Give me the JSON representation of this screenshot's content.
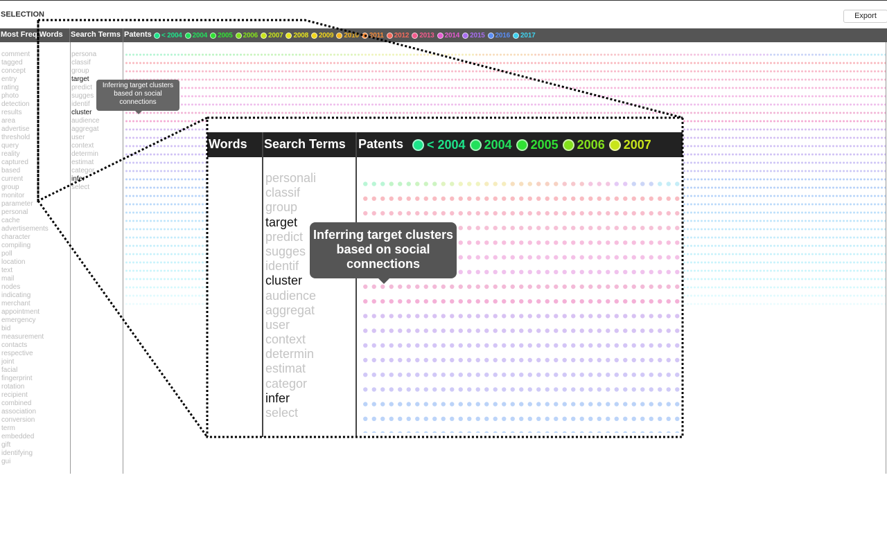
{
  "title": "SELECTION",
  "export_label": "Export",
  "columns": {
    "words": "Most Freq Words",
    "search_terms": "Search Terms",
    "patents": "Patents"
  },
  "legend": [
    {
      "label": "< 2004",
      "color": "#1de38a"
    },
    {
      "label": "2004",
      "color": "#22e05c"
    },
    {
      "label": "2005",
      "color": "#31e034"
    },
    {
      "label": "2006",
      "color": "#83e01c"
    },
    {
      "label": "2007",
      "color": "#c8e41b"
    },
    {
      "label": "2008",
      "color": "#e6e41c"
    },
    {
      "label": "2009",
      "color": "#f0d51c"
    },
    {
      "label": "2010",
      "color": "#f3b41f"
    },
    {
      "label": "2011",
      "color": "#f48a3a"
    },
    {
      "label": "2012",
      "color": "#f26a5c"
    },
    {
      "label": "2013",
      "color": "#f25b8d"
    },
    {
      "label": "2014",
      "color": "#e45ad0"
    },
    {
      "label": "2015",
      "color": "#a86ef0"
    },
    {
      "label": "2016",
      "color": "#5a8df3"
    },
    {
      "label": "2017",
      "color": "#3fd2ee"
    }
  ],
  "freq_words": [
    "comment",
    "tagged",
    "concept",
    "entry",
    "rating",
    "photo",
    "detection",
    "results",
    "area",
    "advertise",
    "threshold",
    "query",
    "reality",
    "captured",
    "based",
    "current",
    "group",
    "monitor",
    "parameter",
    "personal",
    "cache",
    "advertisements",
    "character",
    "compiling",
    "poll",
    "location",
    "text",
    "mail",
    "nodes",
    "indicating",
    "merchant",
    "appointment",
    "emergency",
    "bid",
    "measurement",
    "contacts",
    "respective",
    "joint",
    "facial",
    "fingerprint",
    "rotation",
    "recipient",
    "combined",
    "association",
    "conversion",
    "term",
    "embedded",
    "gift",
    "identifying",
    "gui"
  ],
  "search_terms": [
    {
      "text": "personali",
      "hl": false
    },
    {
      "text": "classif",
      "hl": false
    },
    {
      "text": "group",
      "hl": false
    },
    {
      "text": "target",
      "hl": true
    },
    {
      "text": "predict",
      "hl": false
    },
    {
      "text": "sugges",
      "hl": false
    },
    {
      "text": "identif",
      "hl": false
    },
    {
      "text": "cluster",
      "hl": true
    },
    {
      "text": "audience",
      "hl": false
    },
    {
      "text": "aggregat",
      "hl": false
    },
    {
      "text": "user",
      "hl": false
    },
    {
      "text": "context",
      "hl": false
    },
    {
      "text": "determin",
      "hl": false
    },
    {
      "text": "estimat",
      "hl": false
    },
    {
      "text": "categor",
      "hl": false
    },
    {
      "text": "infer",
      "hl": true
    },
    {
      "text": "select",
      "hl": false
    }
  ],
  "search_terms_small": [
    "persona",
    "classif",
    "group",
    "target",
    "predict",
    "sugges",
    "identif",
    "cluster",
    "audience",
    "aggregat",
    "user",
    "context",
    "determin",
    "estimat",
    "categor",
    "infer",
    "select"
  ],
  "tooltip": {
    "text": "Inferring target clusters based on social connections"
  },
  "zoom": {
    "words_label": "Words",
    "search_terms_label": "Search Terms",
    "patents_label": "Patents",
    "legend": [
      {
        "label": "< 2004",
        "color": "#1de38a"
      },
      {
        "label": "2004",
        "color": "#22e05c"
      },
      {
        "label": "2005",
        "color": "#31e034"
      },
      {
        "label": "2006",
        "color": "#83e01c"
      },
      {
        "label": "2007",
        "color": "#c8e41b"
      }
    ],
    "tooltip_text": "Inferring target clusters based on social connections"
  },
  "row_colors": [
    "rainbow",
    "#f7a0a8",
    "#f5a3b8",
    "#f2a6c6",
    "#f4a3d0",
    "#f0a6dd",
    "#e9a8e6",
    "#ee9cc8",
    "#f090c6",
    "#c7a8ee",
    "#c4aaf0",
    "#c2acf2",
    "#c0aef2",
    "#bdb1f3",
    "#bbb4f3",
    "#9ec0f5",
    "#9fc2f6",
    "#9fc6f7",
    "#a3cdf8",
    "#a7d6f9",
    "#aadcf9",
    "#aee2fa",
    "#b1e6fa",
    "#b2e9fa",
    "#b6eefa",
    "#b8f0fb",
    "#b9f2fb",
    "#bbf3fb",
    "#c8f6fc",
    "#d5f8fd",
    "#e3fafd"
  ]
}
